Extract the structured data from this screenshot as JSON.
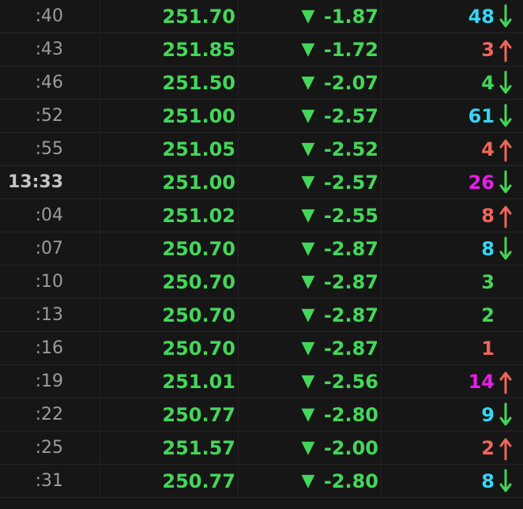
{
  "colors": {
    "background": "#161616",
    "price": "#44d65a",
    "change_down": "#44d65a",
    "vol_cyan": "#36d6f4",
    "vol_red": "#f0665a",
    "vol_green": "#44d65a",
    "vol_magenta": "#e81ee8",
    "arrow_up": "#f0665a",
    "arrow_down": "#44d65a"
  },
  "rows": [
    {
      "time": ":40",
      "price": "251.70",
      "change_icon": "down-triangle",
      "change": "-1.87",
      "volume": "48",
      "vol_color": "cyan",
      "arrow": "down"
    },
    {
      "time": ":43",
      "price": "251.85",
      "change_icon": "down-triangle",
      "change": "-1.72",
      "volume": "3",
      "vol_color": "red",
      "arrow": "up"
    },
    {
      "time": ":46",
      "price": "251.50",
      "change_icon": "down-triangle",
      "change": "-2.07",
      "volume": "4",
      "vol_color": "green",
      "arrow": "down"
    },
    {
      "time": ":52",
      "price": "251.00",
      "change_icon": "down-triangle",
      "change": "-2.57",
      "volume": "61",
      "vol_color": "cyan",
      "arrow": "down"
    },
    {
      "time": ":55",
      "price": "251.05",
      "change_icon": "down-triangle",
      "change": "-2.52",
      "volume": "4",
      "vol_color": "red",
      "arrow": "up"
    },
    {
      "time": "13:33",
      "price": "251.00",
      "change_icon": "down-triangle",
      "change": "-2.57",
      "volume": "26",
      "vol_color": "magenta",
      "arrow": "down",
      "major": true
    },
    {
      "time": ":04",
      "price": "251.02",
      "change_icon": "down-triangle",
      "change": "-2.55",
      "volume": "8",
      "vol_color": "red",
      "arrow": "up"
    },
    {
      "time": ":07",
      "price": "250.70",
      "change_icon": "down-triangle",
      "change": "-2.87",
      "volume": "8",
      "vol_color": "cyan",
      "arrow": "down"
    },
    {
      "time": ":10",
      "price": "250.70",
      "change_icon": "down-triangle",
      "change": "-2.87",
      "volume": "3",
      "vol_color": "green",
      "arrow": "none"
    },
    {
      "time": ":13",
      "price": "250.70",
      "change_icon": "down-triangle",
      "change": "-2.87",
      "volume": "2",
      "vol_color": "green",
      "arrow": "none"
    },
    {
      "time": ":16",
      "price": "250.70",
      "change_icon": "down-triangle",
      "change": "-2.87",
      "volume": "1",
      "vol_color": "red",
      "arrow": "none"
    },
    {
      "time": ":19",
      "price": "251.01",
      "change_icon": "down-triangle",
      "change": "-2.56",
      "volume": "14",
      "vol_color": "magenta",
      "arrow": "up"
    },
    {
      "time": ":22",
      "price": "250.77",
      "change_icon": "down-triangle",
      "change": "-2.80",
      "volume": "9",
      "vol_color": "cyan",
      "arrow": "down"
    },
    {
      "time": ":25",
      "price": "251.57",
      "change_icon": "down-triangle",
      "change": "-2.00",
      "volume": "2",
      "vol_color": "red",
      "arrow": "up"
    },
    {
      "time": ":31",
      "price": "250.77",
      "change_icon": "down-triangle",
      "change": "-2.80",
      "volume": "8",
      "vol_color": "cyan",
      "arrow": "down"
    }
  ]
}
